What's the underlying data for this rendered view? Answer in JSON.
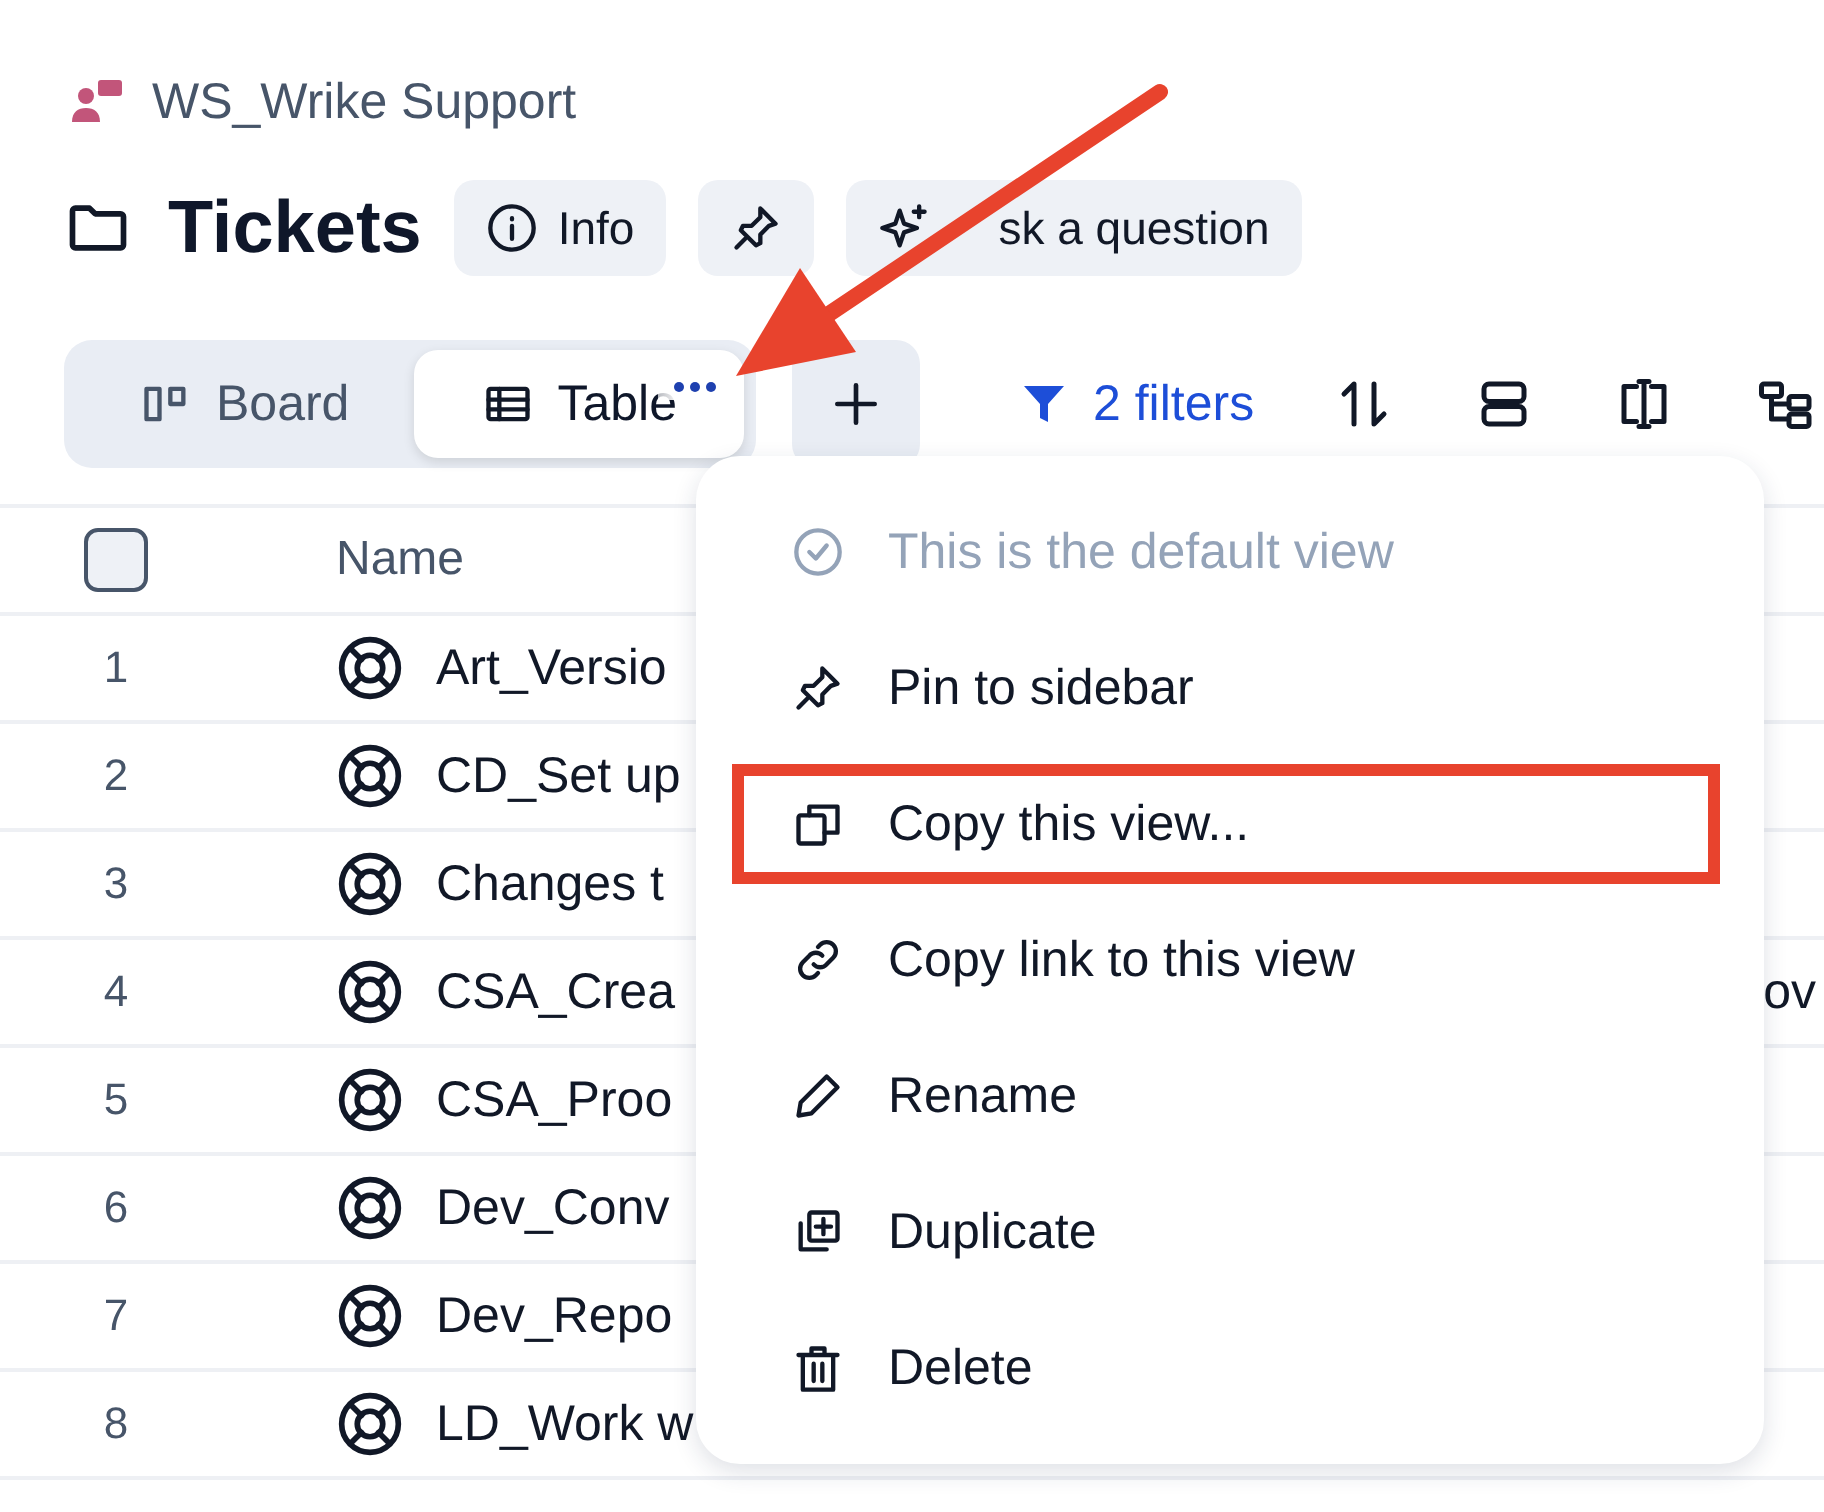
{
  "workspace": {
    "name": "WS_Wrike Support"
  },
  "title": "Tickets",
  "header_buttons": [
    {
      "kind": "info",
      "label": "Info"
    },
    {
      "kind": "pin"
    },
    {
      "kind": "ask",
      "label": "sk a question"
    }
  ],
  "views": [
    {
      "kind": "board",
      "label": "Board",
      "selected": false
    },
    {
      "kind": "table",
      "label": "Table",
      "selected": true
    }
  ],
  "filters": "2 filters",
  "table": {
    "select_all_checked": false,
    "columns": [
      "Name"
    ],
    "rows": [
      {
        "number": "1",
        "name": "Art_Versio"
      },
      {
        "number": "2",
        "name": "CD_Set up"
      },
      {
        "number": "3",
        "name": "Changes t"
      },
      {
        "number": "4",
        "name": "CSA_Crea",
        "tail": "ov"
      },
      {
        "number": "5",
        "name": "CSA_Proo"
      },
      {
        "number": "6",
        "name": "Dev_Conv"
      },
      {
        "number": "7",
        "name": "Dev_Repo"
      },
      {
        "number": "8",
        "name": "LD_Work w"
      }
    ]
  },
  "menu": {
    "items": [
      {
        "kind": "default",
        "label": "This is the default view",
        "disabled": true,
        "highlighted": false
      },
      {
        "kind": "pin",
        "label": "Pin to sidebar",
        "disabled": false,
        "highlighted": false
      },
      {
        "kind": "copy",
        "label": "Copy this view...",
        "disabled": false,
        "highlighted": true
      },
      {
        "kind": "link",
        "label": "Copy link to this view",
        "disabled": false,
        "highlighted": false
      },
      {
        "kind": "rename",
        "label": "Rename",
        "disabled": false,
        "highlighted": false
      },
      {
        "kind": "duplicate",
        "label": "Duplicate",
        "disabled": false,
        "highlighted": false
      },
      {
        "kind": "delete",
        "label": "Delete",
        "disabled": false,
        "highlighted": false
      }
    ]
  }
}
